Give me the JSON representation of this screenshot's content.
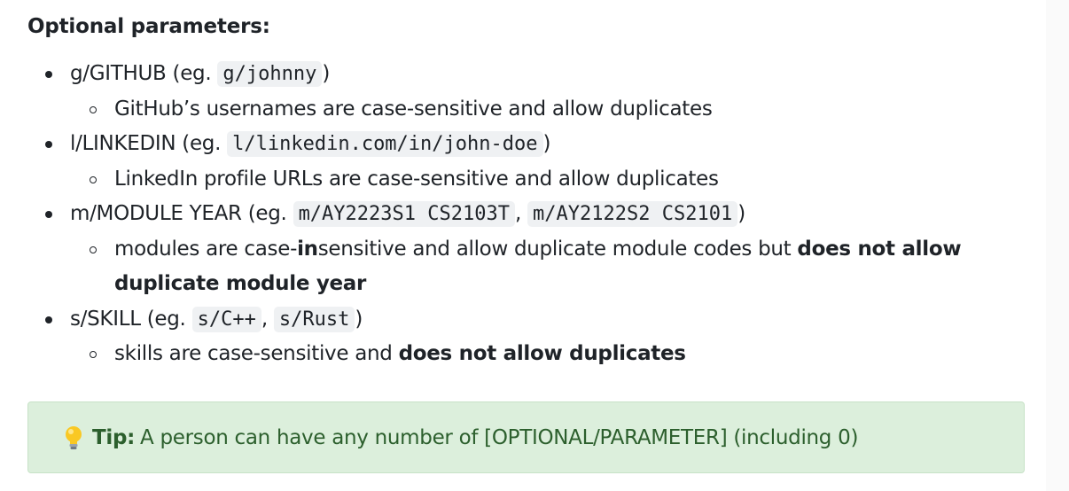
{
  "heading": "Optional parameters:",
  "params": [
    {
      "prefix": "g/GITHUB (eg. ",
      "codes": [
        "g/johnny"
      ],
      "suffix": ")",
      "note": {
        "text_before": "GitHub’s usernames are case-sensitive and allow duplicates"
      }
    },
    {
      "prefix": "l/LINKEDIN (eg. ",
      "codes": [
        "l/linkedin.com/in/john-doe"
      ],
      "suffix": ")",
      "note": {
        "text_before": "LinkedIn profile URLs are case-sensitive and allow duplicates"
      }
    },
    {
      "prefix": "m/MODULE YEAR (eg. ",
      "codes": [
        "m/AY2223S1 CS2103T",
        "m/AY2122S2 CS2101"
      ],
      "separator": ", ",
      "suffix": ")",
      "note": {
        "text_before": "modules are case-",
        "bold_in": "in",
        "text_middle": "sensitive and allow duplicate module codes but ",
        "bold_end": "does not allow duplicate module year"
      }
    },
    {
      "prefix": "s/SKILL (eg. ",
      "codes": [
        "s/C++",
        "s/Rust"
      ],
      "separator": ", ",
      "suffix": ")",
      "note": {
        "text_before": "skills are case-sensitive and ",
        "bold_end": "does not allow duplicates"
      }
    }
  ],
  "tip": {
    "icon": "lightbulb-icon",
    "label": "Tip:",
    "text": "A person can have any number of [OPTIONAL/PARAMETER] (including 0)"
  },
  "colors": {
    "tip_background": "#dcefdc",
    "tip_text": "#2c5f2d",
    "code_background": "#eff1f3"
  }
}
